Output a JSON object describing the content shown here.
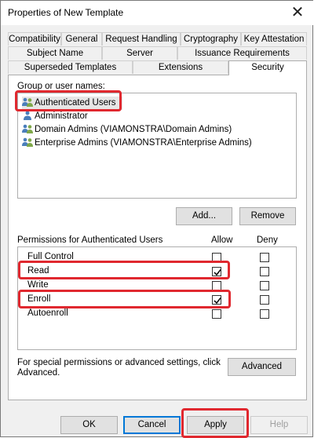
{
  "window": {
    "title": "Properties of New Template"
  },
  "tabs": {
    "row1": [
      "Compatibility",
      "General",
      "Request Handling",
      "Cryptography",
      "Key Attestation"
    ],
    "row2": [
      "Subject Name",
      "Server",
      "Issuance Requirements"
    ],
    "row3": [
      "Superseded Templates",
      "Extensions",
      "Security"
    ]
  },
  "groups": {
    "label": "Group or user names:",
    "items": [
      "Authenticated Users",
      "Administrator",
      "Domain Admins (VIAMONSTRA\\Domain Admins)",
      "Enterprise Admins (VIAMONSTRA\\Enterprise Admins)"
    ],
    "add_label": "Add...",
    "remove_label": "Remove"
  },
  "permissions": {
    "header": "Permissions for Authenticated Users",
    "allow_label": "Allow",
    "deny_label": "Deny",
    "rows": [
      {
        "name": "Full Control",
        "allow": false,
        "deny": false
      },
      {
        "name": "Read",
        "allow": true,
        "deny": false
      },
      {
        "name": "Write",
        "allow": false,
        "deny": false
      },
      {
        "name": "Enroll",
        "allow": true,
        "deny": false
      },
      {
        "name": "Autoenroll",
        "allow": false,
        "deny": false
      }
    ]
  },
  "special": {
    "text_line1": "For special permissions or advanced settings, click",
    "text_line2": "Advanced.",
    "advanced_label": "Advanced"
  },
  "footer": {
    "ok": "OK",
    "cancel": "Cancel",
    "apply": "Apply",
    "help": "Help"
  },
  "colors": {
    "highlight": "#e0282f",
    "accent": "#0078d7"
  }
}
